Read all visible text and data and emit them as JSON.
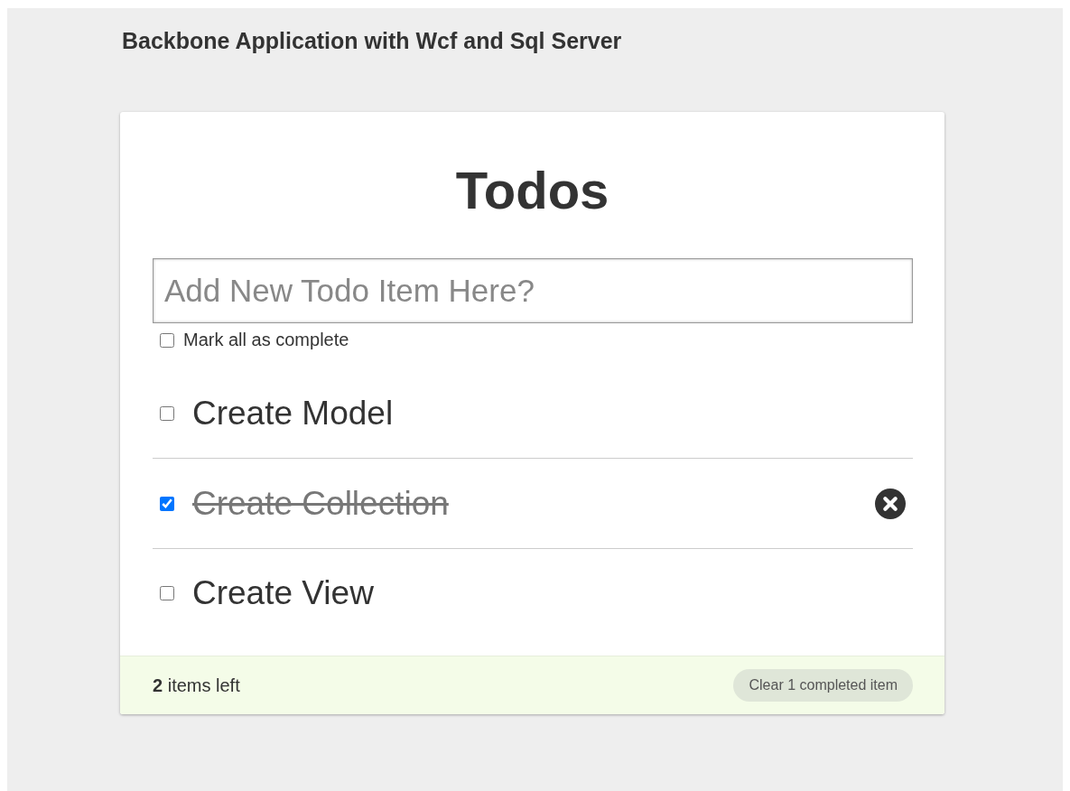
{
  "page": {
    "heading": "Backbone Application with Wcf and Sql Server"
  },
  "todo_app": {
    "title": "Todos",
    "new_todo": {
      "placeholder": "Add New Todo Item Here?"
    },
    "mark_all": {
      "label": "Mark all as complete",
      "checked": false
    },
    "items": [
      {
        "text": "Create Model",
        "checked": false,
        "hovered": false
      },
      {
        "text": "Create Collection",
        "checked": true,
        "hovered": true
      },
      {
        "text": "Create View",
        "checked": false,
        "hovered": false
      }
    ],
    "footer": {
      "count": "**2** items left",
      "clear_button": "Clear 1 completed item"
    }
  }
}
